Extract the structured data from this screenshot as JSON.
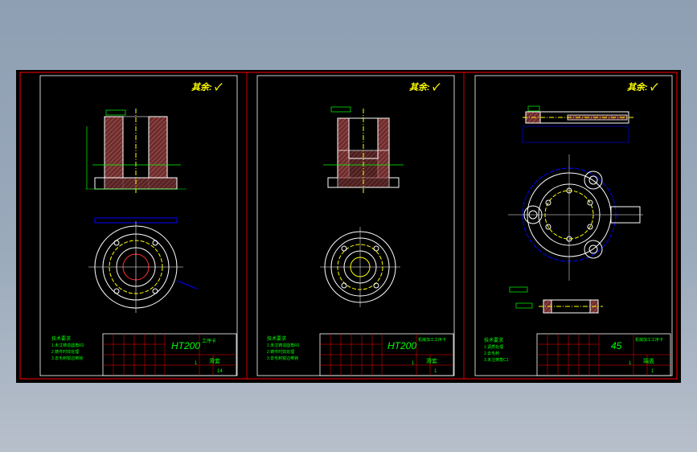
{
  "sheets": [
    {
      "roughness": "其余: ✓",
      "material": "HT200",
      "doc_title": "工序卡",
      "doc_subtitle": "",
      "part_name": "滑套",
      "qty": "1",
      "sheet": "14",
      "notes": [
        "技术要求",
        "1.未注铸造圆角R2",
        "2.铸件时效处理",
        "3.去毛刺锐边倒钝"
      ]
    },
    {
      "roughness": "其余: ✓",
      "material": "HT200",
      "doc_title": "机械加工工序卡",
      "doc_subtitle": "",
      "part_name": "滑套",
      "qty": "1",
      "sheet": "1",
      "notes": [
        "技术要求",
        "1.未注铸造圆角R2",
        "2.铸件时效处理",
        "3.去毛刺锐边倒钝"
      ]
    },
    {
      "roughness": "其余: ✓",
      "material": "45",
      "doc_title": "机械加工工序卡",
      "doc_subtitle": "",
      "part_name": "端盖",
      "qty": "1",
      "sheet": "1",
      "notes": [
        "技术要求",
        "1.调质处理",
        "2.去毛刺",
        "3.未注倒角C1"
      ]
    }
  ],
  "colors": {
    "background": "#000000",
    "frame": "#ff0000",
    "outline": "#ffffff",
    "dimension": "#00ff00",
    "centerline": "#ffff00",
    "section": "#8b3a3a",
    "hidden": "#0000ff"
  }
}
